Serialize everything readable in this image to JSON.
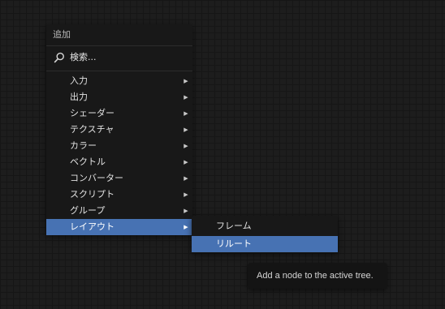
{
  "add_menu": {
    "title": "追加",
    "search_label": "検索...",
    "items": [
      {
        "label": "入力",
        "submenu_arrow": "▶"
      },
      {
        "label": "出力",
        "submenu_arrow": "▶"
      },
      {
        "label": "シェーダー",
        "submenu_arrow": "▶"
      },
      {
        "label": "テクスチャ",
        "submenu_arrow": "▶"
      },
      {
        "label": "カラー",
        "submenu_arrow": "▶"
      },
      {
        "label": "ベクトル",
        "submenu_arrow": "▶"
      },
      {
        "label": "コンバーター",
        "submenu_arrow": "▶"
      },
      {
        "label": "スクリプト",
        "submenu_arrow": "▶"
      },
      {
        "label": "グループ",
        "submenu_arrow": "▶"
      },
      {
        "label": "レイアウト",
        "submenu_arrow": "▶",
        "active": true
      }
    ]
  },
  "layout_submenu": {
    "items": [
      {
        "label": "フレーム"
      },
      {
        "label": "リルート",
        "active": true
      }
    ]
  },
  "tooltip": {
    "text": "Add a node to the active tree."
  },
  "colors": {
    "background": "#1d1d1d",
    "grid_line": "#161616",
    "menu_bg": "#181818",
    "highlight": "#4772b3",
    "text": "#e2e2e2"
  },
  "icons": {
    "search": "search-icon",
    "submenu_arrow": "chevron-right-icon"
  }
}
